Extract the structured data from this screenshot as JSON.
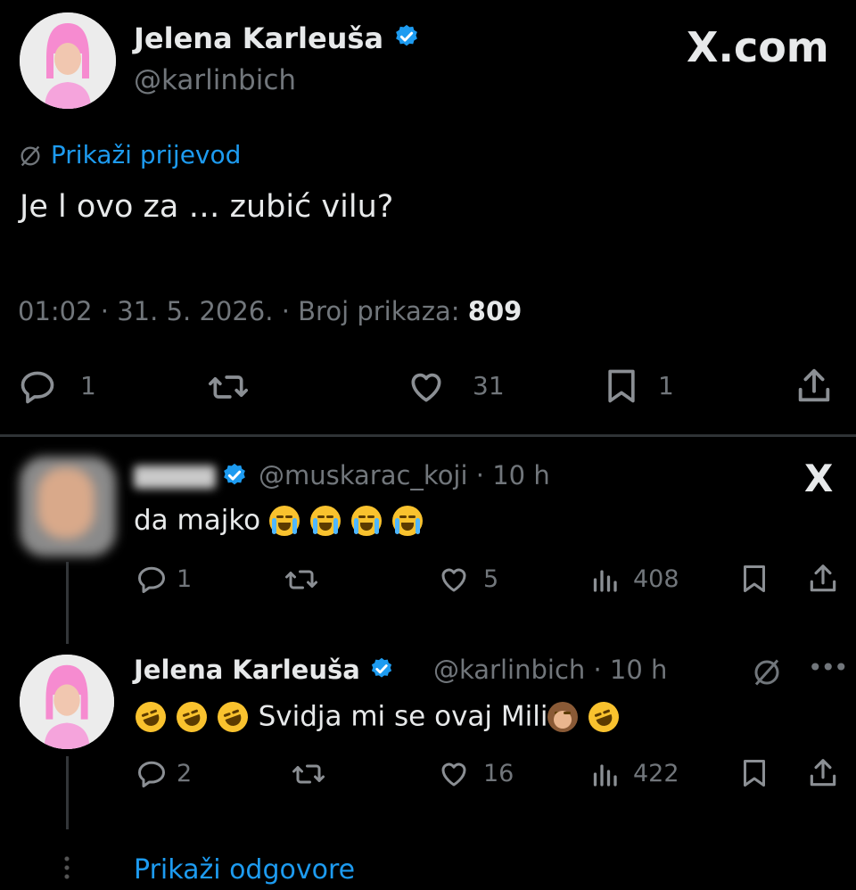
{
  "brand": {
    "watermark": "X.com",
    "reply_logo": "X"
  },
  "main_tweet": {
    "author_name": "Jelena Karleuša",
    "author_handle": "@karlinbich",
    "translate_label": "Prikaži prijevod",
    "text": "Je l ovo za … zubić vilu?",
    "time": "01:02",
    "date": "31. 5. 2026.",
    "views_label": "Broj prikaza:",
    "views": "809",
    "actions": {
      "replies": "1",
      "likes": "31",
      "bookmarks": "1"
    }
  },
  "reply_1": {
    "author_handle": "@muskarac_koji",
    "time": "10 h",
    "text": "da majko",
    "emoji_icons": [
      "loudly-crying-face-icon",
      "loudly-crying-face-icon",
      "loudly-crying-face-icon",
      "loudly-crying-face-icon"
    ],
    "actions": {
      "replies": "1",
      "likes": "5",
      "views": "408"
    }
  },
  "reply_2": {
    "author_name": "Jelena Karleuša",
    "author_handle": "@karlinbich",
    "time": "10 h",
    "text": "Svidja mi se ovaj Mili",
    "actions": {
      "replies": "2",
      "likes": "16",
      "views": "422"
    }
  },
  "show_replies_label": "Prikaži odgovore",
  "colors": {
    "accent": "#1d9bf0",
    "background": "#000000",
    "muted": "#71767b",
    "text": "#e7e9ea"
  }
}
